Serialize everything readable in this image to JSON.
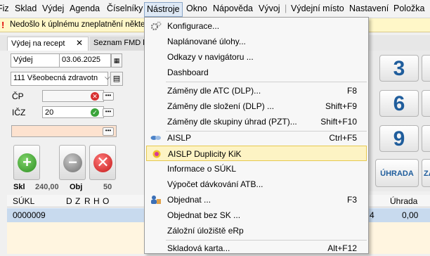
{
  "menubar": {
    "items": [
      "Fiz",
      "Sklad",
      "Výdej",
      "Agenda",
      "Číselníky",
      "Nástroje",
      "Okno",
      "Nápověda",
      "Vývoj",
      "Výdejní místo",
      "Nastavení",
      "Položka"
    ]
  },
  "warning": {
    "text": "Nedošlo k úplnému zneplatnění někte"
  },
  "tabs": {
    "issue": "Výdej na recept",
    "fmd": "Seznam FMD k"
  },
  "form": {
    "type_value": "Výdej",
    "date_value": "03.06.2025",
    "insurer_value": "111 Všeobecná zdravotn",
    "cp_label": "ČP",
    "icz_label": "IČZ",
    "icz_value": "20",
    "dots": "•••"
  },
  "totals": {
    "skl_label": "Skl",
    "skl_value": "240,00",
    "obj_label": "Obj",
    "obj_value": "50"
  },
  "grid": {
    "columns": [
      "SÚKL",
      "D",
      "Z",
      "R",
      "H",
      "O"
    ],
    "right_columns": [
      "Úhrada"
    ],
    "rows": [
      {
        "sukl": "0000009",
        "mid": "4",
        "uhrada": "0,00"
      }
    ]
  },
  "keypad": {
    "k3": "3",
    "k6": "6",
    "k9": "9",
    "payment": "ÚHRADA",
    "partial": "ZÁ"
  },
  "menu": {
    "items": [
      {
        "label": "Konfigurace...",
        "shortcut": ""
      },
      {
        "label": "Naplánované úlohy...",
        "shortcut": ""
      },
      {
        "label": "Odkazy v navigátoru ...",
        "shortcut": ""
      },
      {
        "label": "Dashboard",
        "shortcut": ""
      },
      {
        "label": "Záměny dle ATC (DLP)...",
        "shortcut": "F8"
      },
      {
        "label": "Záměny dle složení (DLP) ...",
        "shortcut": "Shift+F9"
      },
      {
        "label": "Záměny dle skupiny úhrad (PZT)...",
        "shortcut": "Shift+F10"
      },
      {
        "label": "AISLP",
        "shortcut": "Ctrl+F5"
      },
      {
        "label": "AISLP Duplicity KiK",
        "shortcut": ""
      },
      {
        "label": "Informace o SÚKL",
        "shortcut": ""
      },
      {
        "label": "Výpočet dávkování ATB...",
        "shortcut": ""
      },
      {
        "label": "Objednat ...",
        "shortcut": "F3"
      },
      {
        "label": "Objednat bez SK ...",
        "shortcut": ""
      },
      {
        "label": "Záložní úložiště eRp",
        "shortcut": ""
      },
      {
        "label": "Skladová karta...",
        "shortcut": "Alt+F12"
      }
    ]
  }
}
